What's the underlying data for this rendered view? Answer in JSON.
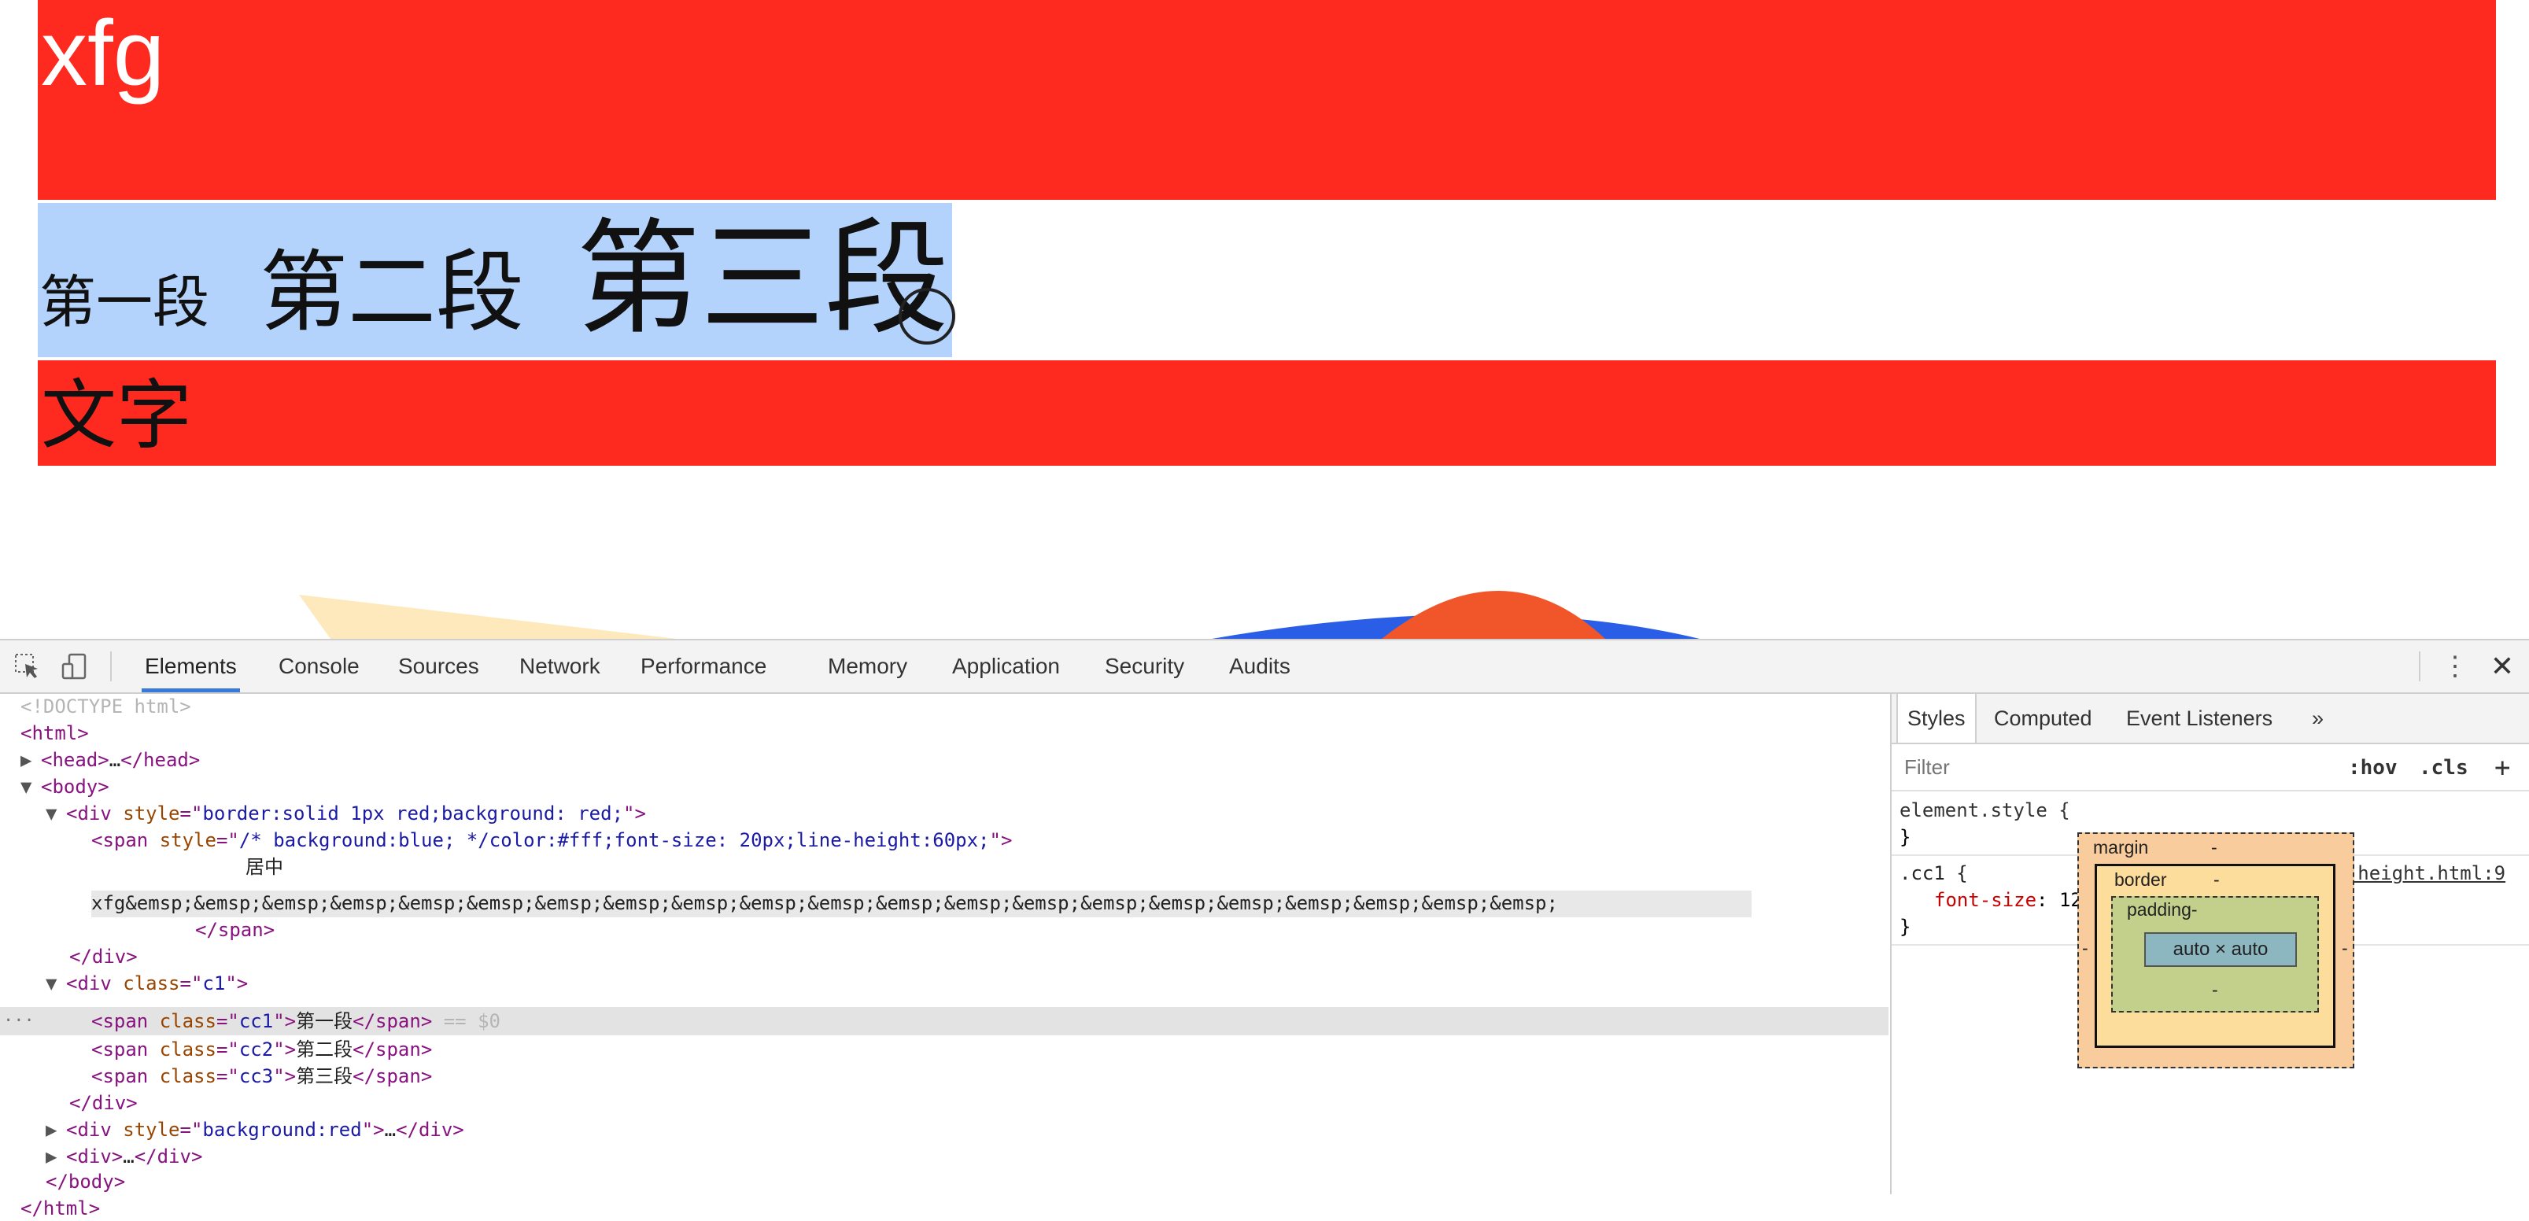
{
  "page": {
    "bar1_text": "xfg",
    "cc1_text": "第一段",
    "cc2_text": "第二段",
    "cc3_text": "第三段",
    "bar3_text": "文字"
  },
  "devtools": {
    "tabs": [
      {
        "label": "Elements",
        "active": true
      },
      {
        "label": "Console"
      },
      {
        "label": "Sources"
      },
      {
        "label": "Network"
      },
      {
        "label": "Performance"
      },
      {
        "label": "Memory"
      },
      {
        "label": "Application"
      },
      {
        "label": "Security"
      },
      {
        "label": "Audits"
      }
    ],
    "more_icon": "⋮",
    "close_icon": "✕",
    "accent_color": "#3879d9"
  },
  "dom": {
    "doctype": "<!DOCTYPE html>",
    "html_open": "<html>",
    "head_open": "<head>",
    "head_ellipsis": "…",
    "head_close": "</head>",
    "body_open": "<body>",
    "div_open": "<div ",
    "div_style_attr": "style",
    "div1_style": "border:solid 1px red;background: red;",
    "gt": ">",
    "span_open": "<span ",
    "span_style_attr": "style",
    "span_style": "/* background:blue; */color:#fff;font-size: 20px;line-height:60px;",
    "eq_quote": "=\"",
    "quote": "\"",
    "text_center": "居中",
    "text_xfg": "xfg&emsp;&emsp;&emsp;&emsp;&emsp;&emsp;&emsp;&emsp;&emsp;&emsp;&emsp;&emsp;&emsp;&emsp;&emsp;&emsp;&emsp;&emsp;&emsp;&emsp;&emsp;",
    "span_close": "</span>",
    "div_close": "</div>",
    "div_class_attr": "class",
    "div_class": "c1",
    "span_class_attr": "class",
    "cc1_class": "cc1",
    "cc1_text": "第一段",
    "selected_marker": " == $0",
    "cc2_class": "cc2",
    "cc2_text": "第二段",
    "cc3_class": "cc3",
    "cc3_text": "第三段",
    "div3_style": "background:red",
    "div3_ellipsis": "…",
    "div4_open": "<div>",
    "div4_ellipsis": "…",
    "body_close": "</body>",
    "html_close": "</html>",
    "dots": "···"
  },
  "styles_panel": {
    "tabs": [
      {
        "label": "Styles",
        "active": true
      },
      {
        "label": "Computed"
      },
      {
        "label": "Event Listeners"
      }
    ],
    "overflow_icon": "»",
    "filter_placeholder": "Filter",
    "hov_label": ":hov",
    "cls_label": ".cls",
    "add_label": "+",
    "element_style_selector": "element.style {",
    "close_brace": "}",
    "rule_selector": ".cc1 {",
    "rule_source": "line-height.html:9",
    "rule_property": "font-size",
    "rule_colon": ": ",
    "rule_value": "12px;",
    "box_model": {
      "margin_label": "margin",
      "border_label": "border",
      "padding_label": "padding-",
      "content": "auto × auto",
      "dash": "-"
    }
  }
}
